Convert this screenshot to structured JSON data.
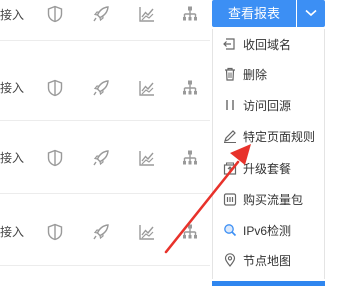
{
  "rows": [
    {
      "label": "接入"
    },
    {
      "label": "接入"
    },
    {
      "label": "接入"
    },
    {
      "label": "接入"
    }
  ],
  "row_icons": [
    "shield-icon",
    "rocket-icon",
    "chart-icon",
    "network-tree-icon"
  ],
  "report": {
    "button_label": "查看报表"
  },
  "menu": {
    "items": [
      {
        "label": "收回域名",
        "icon": "return-icon"
      },
      {
        "label": "删除",
        "icon": "trash-icon"
      },
      {
        "label": "访问回源",
        "icon": "pause-icon"
      },
      {
        "label": "特定页面规则",
        "icon": "pencil-icon"
      },
      {
        "label": "升级套餐",
        "icon": "upgrade-icon"
      },
      {
        "label": "购买流量包",
        "icon": "package-icon"
      },
      {
        "label": "IPv6检测",
        "icon": "search-icon"
      },
      {
        "label": "节点地图",
        "icon": "location-pin-icon"
      }
    ]
  },
  "colors": {
    "primary": "#3c8ff4",
    "annotation": "#e8322b",
    "icon_gray": "#9a9a9a"
  }
}
